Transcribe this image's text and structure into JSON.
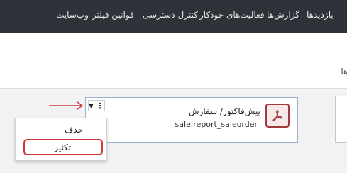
{
  "topbar": {
    "items": [
      {
        "label": "بازدیدها"
      },
      {
        "label": "گزارش‌ها"
      },
      {
        "label": "فعالیت‌های خودکار"
      },
      {
        "label": "کنترل دسترسی"
      },
      {
        "label": "قوانین فیلتر"
      },
      {
        "label": "وب‌سایت"
      }
    ]
  },
  "breadcrumb": {
    "text": "بندی‌ها"
  },
  "card": {
    "title": "پیش‌فاکتور/ سفارش",
    "technical_name": "sale.report_saleorder",
    "icon": "pdf-icon"
  },
  "dropdown": {
    "items": [
      {
        "label": "حذف"
      },
      {
        "label": "تکثیر"
      }
    ]
  },
  "colors": {
    "topbar_bg": "#2f3238",
    "accent_red": "#d23a3a",
    "pdf_red": "#a23b3b",
    "card_border": "#9eaed0"
  }
}
